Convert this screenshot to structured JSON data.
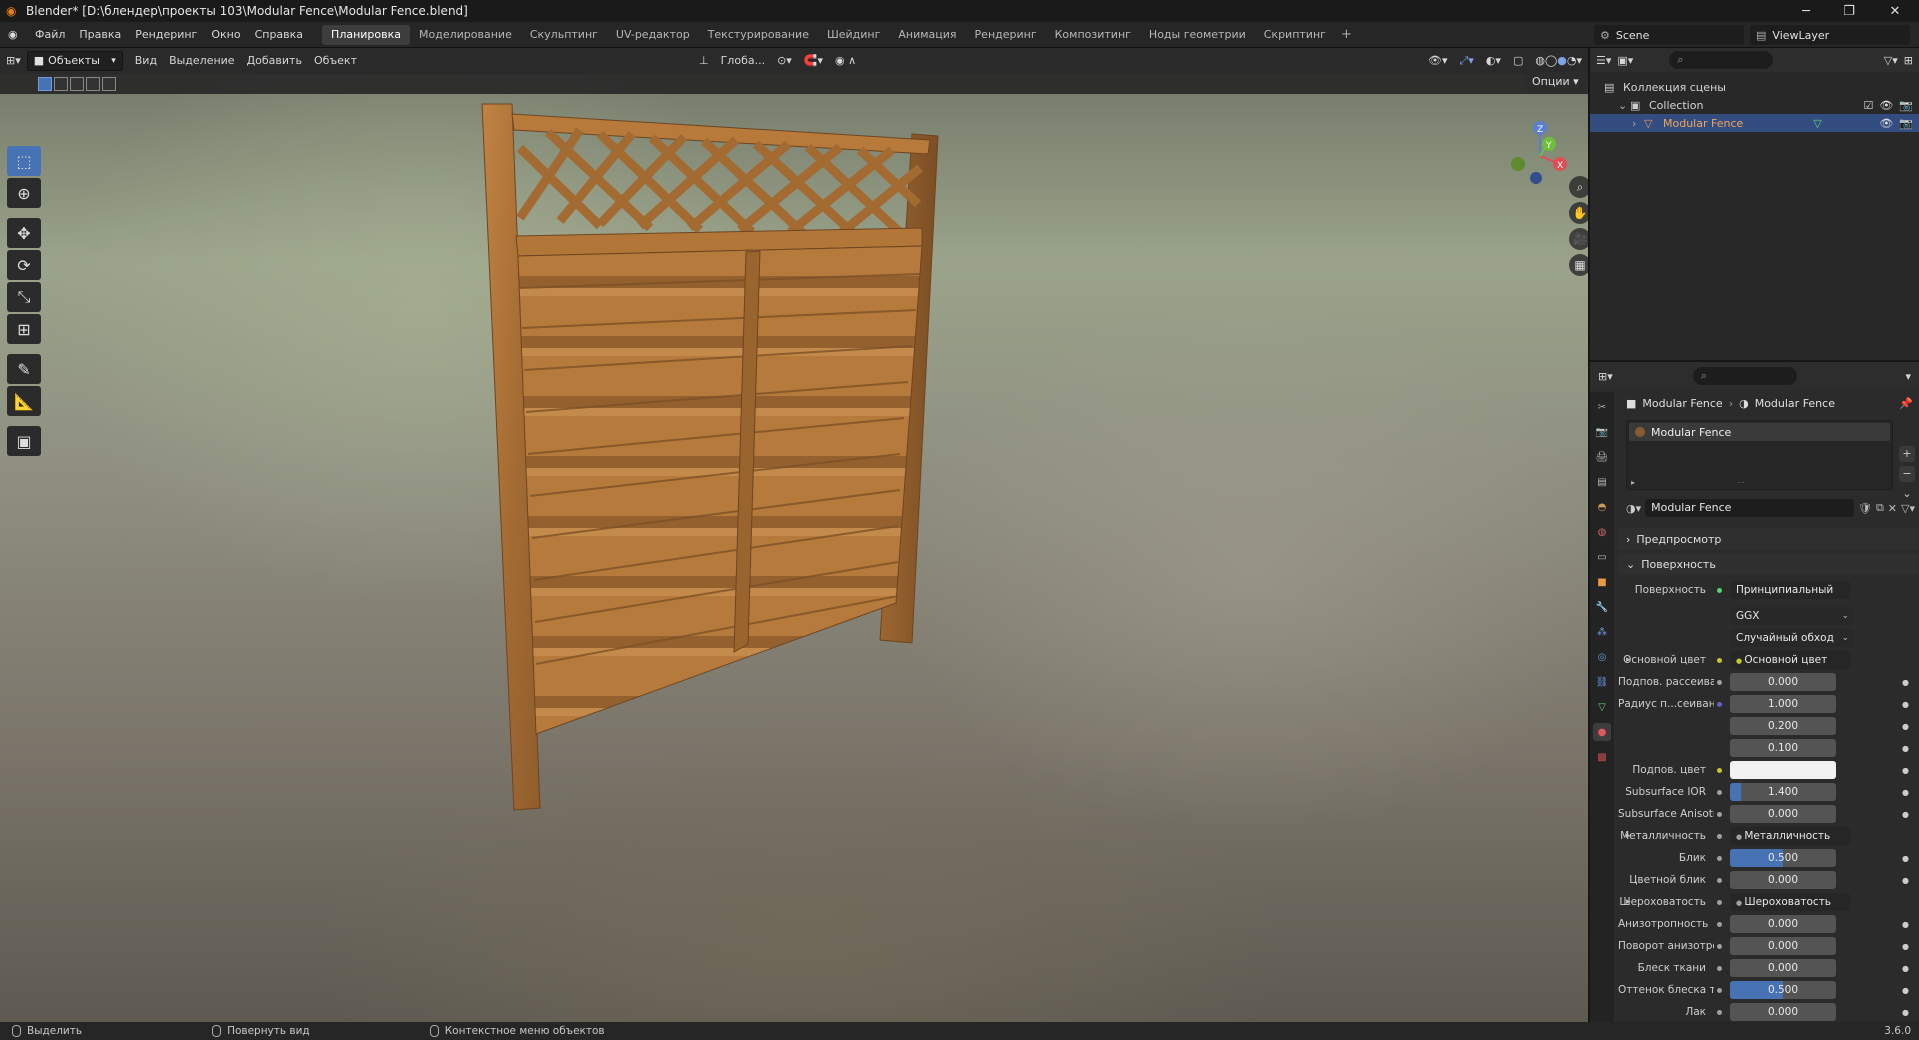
{
  "window": {
    "title": "Blender* [D:\\блендер\\проекты 103\\Modular Fence\\Modular Fence.blend]",
    "controls": [
      "─",
      "❐",
      "✕"
    ]
  },
  "menu": [
    "Файл",
    "Правка",
    "Рендеринг",
    "Окно",
    "Справка"
  ],
  "workspaces": {
    "tabs": [
      "Планировка",
      "Моделирование",
      "Скульптинг",
      "UV-редактор",
      "Текстурирование",
      "Шейдинг",
      "Анимация",
      "Рендеринг",
      "Композитинг",
      "Ноды геометрии",
      "Скриптинг"
    ],
    "active": 0,
    "add": "+"
  },
  "scene": {
    "scene_name": "Scene",
    "view_layer": "ViewLayer"
  },
  "viewport_header": {
    "mode": "Объекты",
    "menus": [
      "Вид",
      "Выделение",
      "Добавить",
      "Объект"
    ],
    "orientation": "Глоба...",
    "options": "Опции"
  },
  "toolbar": {
    "tools": [
      {
        "name": "select-box",
        "glyph": "⬚",
        "active": true
      },
      {
        "name": "cursor",
        "glyph": "⊕"
      },
      {
        "name": "move",
        "glyph": "✥"
      },
      {
        "name": "rotate",
        "glyph": "⟳"
      },
      {
        "name": "scale",
        "glyph": "⤡"
      },
      {
        "name": "transform",
        "glyph": "⊞"
      },
      {
        "name": "annotate",
        "glyph": "✎"
      },
      {
        "name": "measure",
        "glyph": "📐"
      },
      {
        "name": "add-cube",
        "glyph": "▣"
      }
    ]
  },
  "gizmo": {
    "x": "X",
    "y": "Y",
    "z": "Z"
  },
  "outliner": {
    "rows": [
      {
        "label": "Коллекция сцены",
        "indent": 0
      },
      {
        "label": "Collection",
        "indent": 1
      },
      {
        "label": "Modular Fence",
        "indent": 2,
        "selected": true
      }
    ]
  },
  "properties": {
    "breadcrumb": [
      "Modular Fence",
      "Modular Fence"
    ],
    "slot": "Modular Fence",
    "material_name": "Modular Fence",
    "panels": {
      "preview": "Предпросмотр",
      "surface": "Поверхность"
    },
    "surface_label": "Поверхность",
    "surface_shader": "Принципиальный BSDF",
    "distribution": "GGX",
    "subsurface_method": "Случайный обход",
    "rows": [
      {
        "label": "Основной цвет",
        "value": "Основной цвет",
        "kind": "link",
        "expand": true,
        "dot": "#c7c729"
      },
      {
        "label": "Подпов. рассеива...",
        "value": "0.000",
        "kind": "num",
        "dot": "#a1a1a1"
      },
      {
        "label": "Радиус п...сеивания",
        "value": "1.000",
        "kind": "num",
        "dot": "#6363c7"
      },
      {
        "label": "",
        "value": "0.200",
        "kind": "num"
      },
      {
        "label": "",
        "value": "0.100",
        "kind": "num"
      },
      {
        "label": "Подпов. цвет",
        "value": "",
        "kind": "color",
        "dot": "#c7c729"
      },
      {
        "label": "Subsurface IOR",
        "value": "1.400",
        "kind": "num",
        "fill": 0.1,
        "dot": "#a1a1a1"
      },
      {
        "label": "Subsurface Anisotr...",
        "value": "0.000",
        "kind": "num",
        "dot": "#a1a1a1"
      },
      {
        "label": "Металличность",
        "value": "Металличность",
        "kind": "link",
        "expand": true,
        "dot": "#a1a1a1"
      },
      {
        "label": "Блик",
        "value": "0.500",
        "kind": "num",
        "fill": 0.5,
        "dot": "#a1a1a1"
      },
      {
        "label": "Цветной блик",
        "value": "0.000",
        "kind": "num",
        "dot": "#a1a1a1"
      },
      {
        "label": "Шероховатость",
        "value": "Шероховатость",
        "kind": "link",
        "expand": true,
        "dot": "#a1a1a1"
      },
      {
        "label": "Анизотропность",
        "value": "0.000",
        "kind": "num",
        "dot": "#a1a1a1"
      },
      {
        "label": "Поворот анизотро...",
        "value": "0.000",
        "kind": "num",
        "dot": "#a1a1a1"
      },
      {
        "label": "Блеск ткани",
        "value": "0.000",
        "kind": "num",
        "dot": "#a1a1a1"
      },
      {
        "label": "Оттенок блеска тк...",
        "value": "0.500",
        "kind": "num",
        "fill": 0.5,
        "dot": "#a1a1a1"
      },
      {
        "label": "Лак",
        "value": "0.000",
        "kind": "num",
        "dot": "#a1a1a1"
      }
    ]
  },
  "statusbar": {
    "select": "Выделить",
    "rotate": "Повернуть вид",
    "context": "Контекстное меню объектов",
    "version": "3.6.0"
  },
  "colors": {
    "accent": "#4772b3",
    "selected_row": "#334d80",
    "wood": "#b3783a"
  }
}
